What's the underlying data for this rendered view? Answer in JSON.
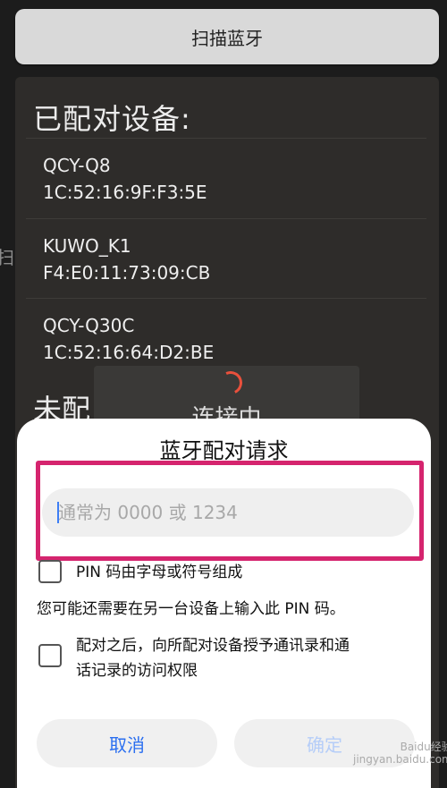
{
  "scan_button": {
    "label": "扫描蓝牙"
  },
  "paired_section": {
    "title": "已配对设备:",
    "devices": [
      {
        "name": "QCY-Q8",
        "mac": "1C:52:16:9F:F3:5E"
      },
      {
        "name": "KUWO_K1",
        "mac": "F4:E0:11:73:09:CB"
      },
      {
        "name": "QCY-Q30C",
        "mac": "1C:52:16:64:D2:BE"
      }
    ]
  },
  "unpaired_section": {
    "title_partial": "未配"
  },
  "background_partial_text": "扫",
  "connecting": {
    "label": "连接中"
  },
  "dialog": {
    "title": "蓝牙配对请求",
    "pin_input": {
      "value": "",
      "placeholder": "通常为 0000 或 1234"
    },
    "pin_letters_checkbox": {
      "label": "PIN 码由字母或符号组成",
      "checked": false
    },
    "info_text": "您可能还需要在另一台设备上输入此 PIN 码。",
    "permission_checkbox": {
      "label_line1": "配对之后，向所配对设备授予通讯录和通",
      "label_line2": "话记录的访问权限",
      "checked": false
    },
    "cancel_label": "取消",
    "ok_label": "确定"
  },
  "colors": {
    "highlight": "#d5246e",
    "accent": "#2b6ff0",
    "spinner": "#e9503c"
  },
  "watermark": {
    "line1": "Baidu经验",
    "line2": "jingyan.baidu.com"
  }
}
